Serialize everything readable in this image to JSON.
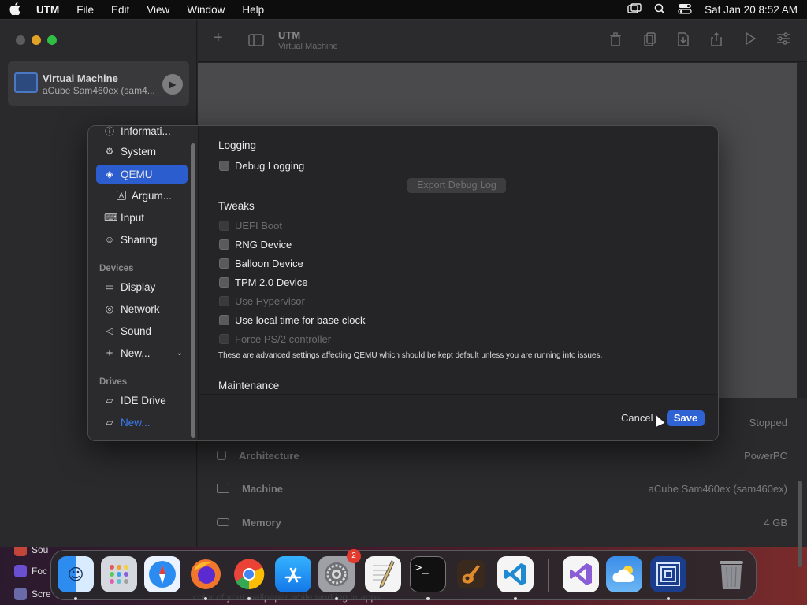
{
  "menubar": {
    "app": "UTM",
    "menus": [
      "File",
      "Edit",
      "View",
      "Window",
      "Help"
    ],
    "datetime": "Sat Jan 20  8:52 AM"
  },
  "sidebar": {
    "vm": {
      "name": "Virtual Machine",
      "subtitle": "aCube Sam460ex (sam4..."
    }
  },
  "toolbar": {
    "title": "UTM",
    "subtitle": "Virtual Machine"
  },
  "details": {
    "status_value": "Stopped",
    "rows": [
      {
        "label": "Architecture",
        "value": "PowerPC"
      },
      {
        "label": "Machine",
        "value": "aCube Sam460ex (sam460ex)"
      },
      {
        "label": "Memory",
        "value": "4 GB"
      }
    ]
  },
  "settings": {
    "nav": {
      "information": "Informati...",
      "system": "System",
      "qemu": "QEMU",
      "arguments": "Argum...",
      "input": "Input",
      "sharing": "Sharing",
      "devices_header": "Devices",
      "display": "Display",
      "network": "Network",
      "sound": "Sound",
      "new_device": "New...",
      "drives_header": "Drives",
      "ide_drive": "IDE Drive",
      "new_drive": "New..."
    },
    "logging_header": "Logging",
    "debug_logging": "Debug Logging",
    "export_debug_log": "Export Debug Log",
    "tweaks_header": "Tweaks",
    "tweaks": {
      "uefi_boot": "UEFI Boot",
      "rng_device": "RNG Device",
      "balloon_device": "Balloon Device",
      "tpm_device": "TPM 2.0 Device",
      "use_hypervisor": "Use Hypervisor",
      "local_time": "Use local time for base clock",
      "force_ps2": "Force PS/2 controller"
    },
    "note": "These are advanced settings affecting QEMU which should be kept default unless you are running into issues.",
    "maintenance_header": "Maintenance",
    "cancel": "Cancel",
    "save": "Save"
  },
  "background": {
    "text": "color of your wallpaper while working in apps",
    "apps": [
      "Sou",
      "Foc",
      "Scre"
    ]
  },
  "dock": {
    "settings_badge": "2"
  }
}
